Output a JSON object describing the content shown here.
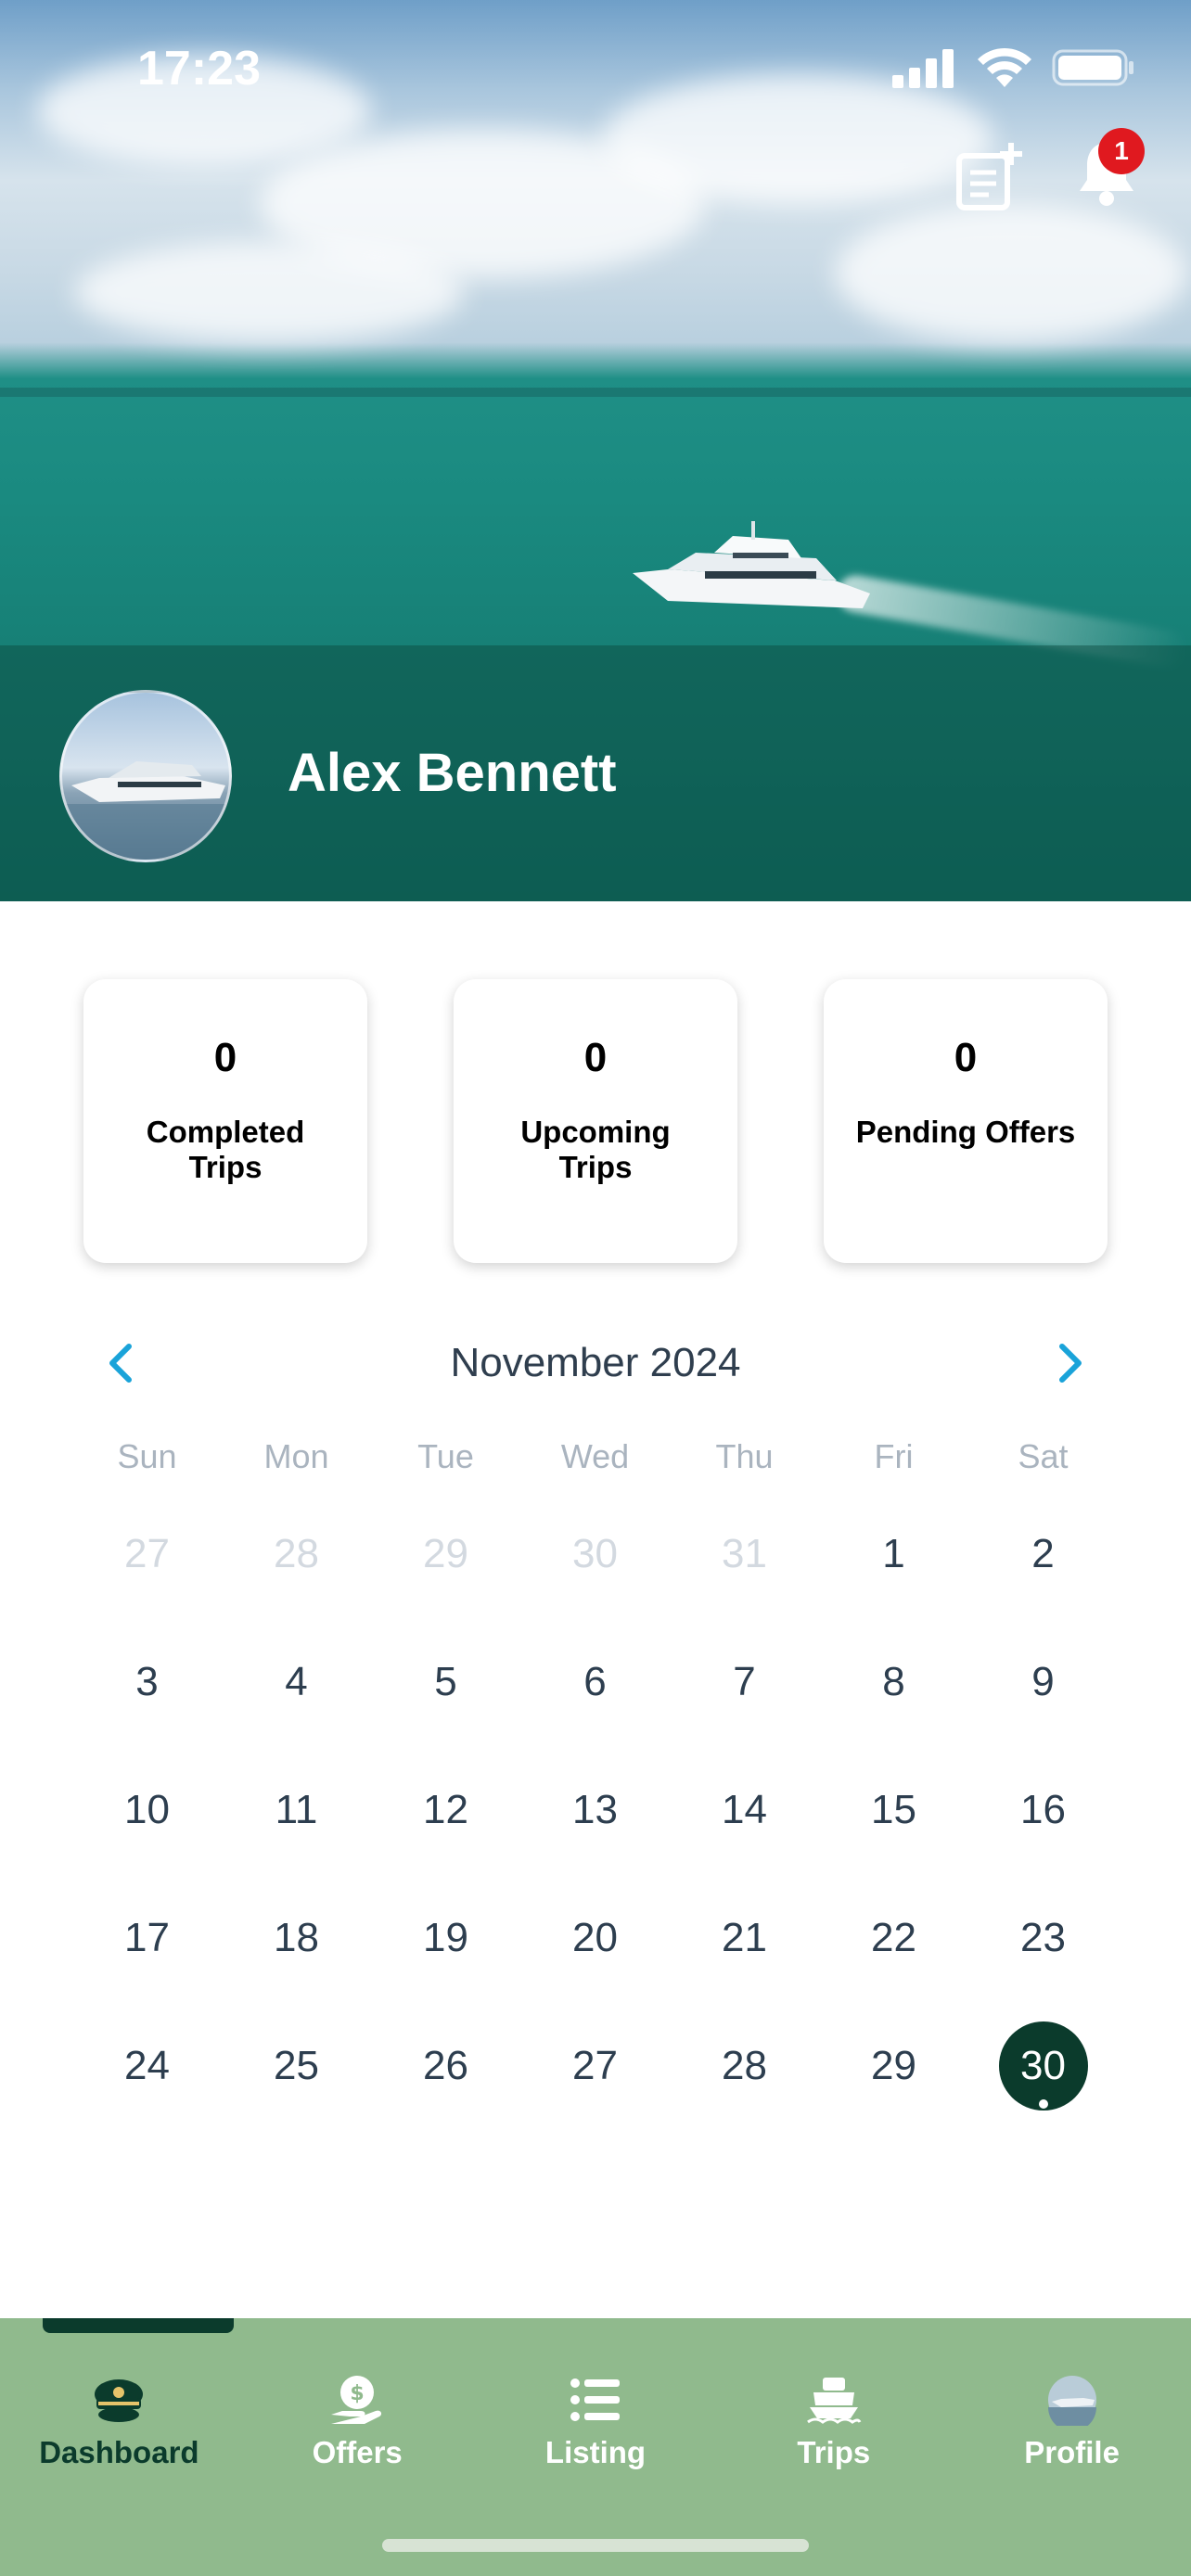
{
  "status_bar": {
    "time": "17:23"
  },
  "header": {
    "notification_count": "1"
  },
  "profile": {
    "name": "Alex Bennett"
  },
  "stats": [
    {
      "value": "0",
      "label": "Completed Trips"
    },
    {
      "value": "0",
      "label": "Upcoming Trips"
    },
    {
      "value": "0",
      "label": "Pending Offers"
    }
  ],
  "calendar": {
    "title": "November 2024",
    "weekdays": [
      "Sun",
      "Mon",
      "Tue",
      "Wed",
      "Thu",
      "Fri",
      "Sat"
    ],
    "weeks": [
      [
        "27",
        "28",
        "29",
        "30",
        "31",
        "1",
        "2"
      ],
      [
        "3",
        "4",
        "5",
        "6",
        "7",
        "8",
        "9"
      ],
      [
        "10",
        "11",
        "12",
        "13",
        "14",
        "15",
        "16"
      ],
      [
        "17",
        "18",
        "19",
        "20",
        "21",
        "22",
        "23"
      ],
      [
        "24",
        "25",
        "26",
        "27",
        "28",
        "29",
        "30"
      ]
    ],
    "selected": "30"
  },
  "tabs": [
    {
      "label": "Dashboard",
      "icon": "captain-hat-icon"
    },
    {
      "label": "Offers",
      "icon": "money-hand-icon"
    },
    {
      "label": "Listing",
      "icon": "list-icon"
    },
    {
      "label": "Trips",
      "icon": "boat-icon"
    },
    {
      "label": "Profile",
      "icon": "profile-avatar-icon"
    }
  ],
  "colors": {
    "accent": "#1aa3d9",
    "dark_green": "#0b3b2c",
    "tab_bg": "#90ba8d",
    "badge": "#e0191f"
  }
}
